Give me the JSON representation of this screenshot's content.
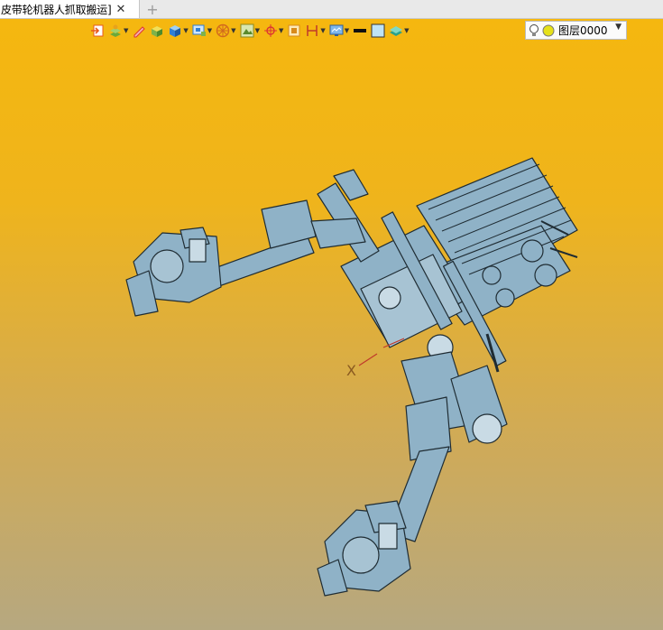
{
  "tab": {
    "title": "皮带轮机器人抓取搬运]",
    "close_glyph": "✕",
    "add_glyph": "+"
  },
  "toolbar": {
    "items": [
      {
        "name": "import-icon",
        "color": "#e85a1c"
      },
      {
        "name": "layer-manager-icon",
        "color": "#6aa83a"
      },
      {
        "name": "pen-icon",
        "color": "#d33"
      },
      {
        "name": "box-icon",
        "color": "#7fb24a"
      },
      {
        "name": "cube-icon",
        "color": "#2f7fd6"
      },
      {
        "name": "view-icon",
        "color": "#2f7fd6"
      },
      {
        "name": "wheel-icon",
        "color": "#d2691e"
      },
      {
        "name": "render-icon",
        "color": "#8a8a20"
      },
      {
        "name": "crosshair-icon",
        "color": "#d33"
      },
      {
        "name": "frame-icon",
        "color": "#d88a1c"
      },
      {
        "name": "dimension-icon",
        "color": "#c0392b"
      },
      {
        "name": "display-icon",
        "color": "#2f7fd6"
      },
      {
        "name": "line-color-icon",
        "color": "#111111"
      },
      {
        "name": "fill-color-icon",
        "color": "#bfe3f5"
      },
      {
        "name": "layers-icon",
        "color": "#2aa18a"
      }
    ]
  },
  "layer": {
    "name": "图层0000"
  },
  "viewport": {
    "axis_label": "X"
  },
  "colors": {
    "model": "#8fb2c7",
    "model_edge": "#2a3a44",
    "bg_top": "#f5b70f",
    "bg_bottom": "#b6a880"
  }
}
